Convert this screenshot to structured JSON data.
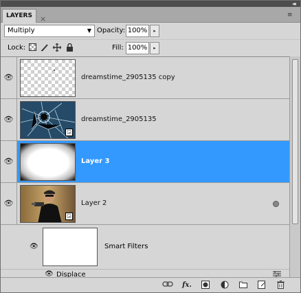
{
  "panel": {
    "tab_label": "LAYERS",
    "tab_close": "×",
    "collapse_glyph": "◂◂",
    "menu_glyph": "≡"
  },
  "blend": {
    "mode": "Multiply",
    "arrow": "▼"
  },
  "opacity": {
    "label": "Opacity:",
    "value": "100%",
    "stepper": "▸"
  },
  "lock": {
    "label": "Lock:",
    "icons": [
      "lock-transparent-icon",
      "lock-image-icon",
      "lock-position-icon",
      "lock-all-icon"
    ]
  },
  "fill": {
    "label": "Fill:",
    "value": "100%",
    "stepper": "▸"
  },
  "layers": [
    {
      "name": "dreamstime_2905135 copy",
      "thumb": "transparent",
      "selected": false,
      "smart": false
    },
    {
      "name": "dreamstime_2905135",
      "thumb": "shattered-glass",
      "selected": false,
      "smart": true
    },
    {
      "name": "Layer 3",
      "thumb": "vignette",
      "selected": true,
      "smart": false
    },
    {
      "name": "Layer 2",
      "thumb": "man-with-gun",
      "selected": false,
      "smart": true
    }
  ],
  "smart_filters": {
    "label": "Smart Filters",
    "filter_name": "Displace"
  },
  "eye_glyph": "👁",
  "colors": {
    "selected_row": "#3399ff",
    "panel_bg": "#d6d6d6"
  }
}
